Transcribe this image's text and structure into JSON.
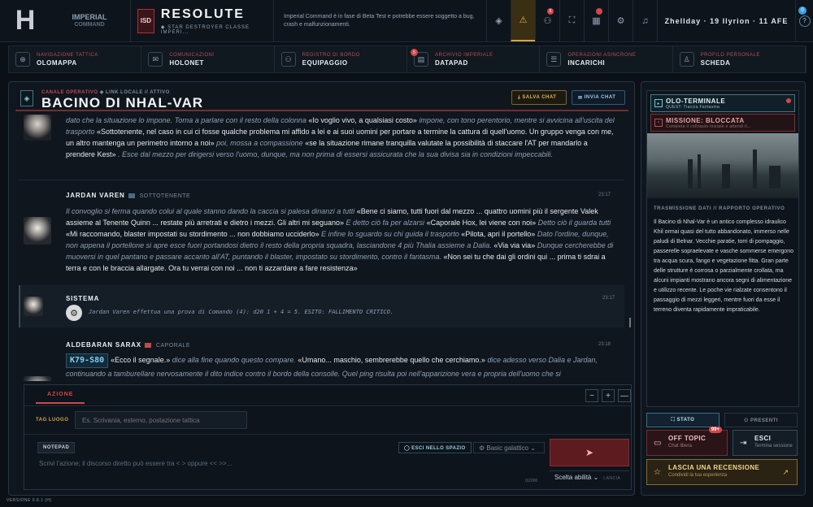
{
  "topbar": {
    "logo": "H",
    "imperial_line1": "IMPERIAL",
    "imperial_line2": "COMMAND",
    "ship_code": "ISD",
    "ship_name": "RESOLUTE",
    "ship_class": "◆ STAR DESTROYER CLASSE IMPERI...",
    "beta_notice": "Imperial Command è in fase di Beta Test e potrebbe essere soggetto a bug, crash e malfunzionamenti.",
    "icons": [
      {
        "name": "starship-icon",
        "glyph": "◈"
      },
      {
        "name": "warning-icon",
        "glyph": "⚠"
      },
      {
        "name": "users-icon",
        "glyph": "⚇",
        "badge": "6"
      },
      {
        "name": "fullscreen-icon",
        "glyph": "⛶"
      },
      {
        "name": "calendar-icon",
        "glyph": "▦",
        "badge": "•"
      },
      {
        "name": "settings-icon",
        "glyph": "⚙"
      },
      {
        "name": "bell-icon",
        "glyph": "♫"
      }
    ],
    "date": "Zhellday · 19 Ilyrion · 11 AFE",
    "help": "?",
    "help_badge": "0"
  },
  "nav": [
    {
      "cat": "NAVIGAZIONE TATTICA",
      "label": "OLOMAPPA",
      "icon": "⊕"
    },
    {
      "cat": "COMUNICAZIONI",
      "label": "HOLONET",
      "icon": "✉"
    },
    {
      "cat": "REGISTRO DI BORDO",
      "label": "EQUIPAGGIO",
      "icon": "⚇"
    },
    {
      "cat": "ARCHIVIO IMPERIALE",
      "label": "DATAPAD",
      "icon": "▤",
      "badge": "5"
    },
    {
      "cat": "OPERAZIONI ASINCRONE",
      "label": "INCARICHI",
      "icon": "☰"
    },
    {
      "cat": "PROFILO PERSONALE",
      "label": "SCHEDA",
      "icon": "♙"
    }
  ],
  "channel": {
    "category": "CANALE OPERATIVO",
    "status": "◆ LINK LOCALE // ATTIVO",
    "title": "BACINO DI NHAL-VAR",
    "save_label": "SALVA CHAT",
    "send_label": "INVIA CHAT"
  },
  "messages": {
    "m1": {
      "text_html": "<i>dato che la situazione lo impone. Torna a parlare con il resto della colonna</i> «Io voglio vivo, a qualsiasi costo» <i>impone, con tono perentorio, mentre si avvicina all'uscita del trasporto</i> «Sottotenente, nel caso in cui ci fosse qualche problema mi affido a lei e ai suoi uomini per portare a termine la cattura di quell'uomo. Un gruppo venga con me, un altro mantenga un perimetro intorno a noi» <i>poi, mossa a compassione</i> «se la situazione rimane tranquilla valutate la possibilità di staccare l'AT per mandarlo a prendere Kest» <i>. Esce dal mezzo per dirigersi verso l'uomo, dunque, ma non prima di essersi assicurata che la sua divisa sia in condizioni impeccabili.</i>"
    },
    "m2": {
      "name": "JARDAN VAREN",
      "rank": "SOTTOTENENTE",
      "time": "23:17",
      "text_html": "<i>Il convoglio si ferma quando colui al quale stanno dando la caccia si palesa dinanzi a tutti</i> «Bene ci siamo, tutti fuori dal mezzo ... quattro uomini più il sergente Valek assieme al Tenente Quinn ... restate più arretrati e dietro i mezzi. Gli altri mi seguano» <i>E detto ciò fa per alzarsi</i> «Caporale Hox, lei viene con noi» <i>Detto ciò il guarda tutti</i> «Mi raccomando, blaster impostati su stordimento ... non dobbiamo ucciderlo» <i>E infine lo sguardo su chi guida il trasporto</i> «Pilota, apri il portello» <i>Dato l'ordine, dunque, non appena il portellone si apre esce fuori portandosi dietro il resto della propria squadra, lasciandone 4 più Thalia assieme a Dalia.</i> «Via via via» <i>Dunque cercherebbe di muoversi in quel pantano e passare accanto all'AT, puntando il blaster, impostato su stordimento, contro il fantasma.</i> «Non sei tu che dai gli ordini qui ... prima ti sdrai a terra e con le braccia allargate. Ora tu verrai con noi ... non ti azzardare a fare resistenza»"
    },
    "m3": {
      "name": "SISTEMA",
      "time": "23:17",
      "text": "Jardan Varen effettua una prova di Comando (4): d20 1 + 4 = 5. ESITO: FALLIMENTO CRITICO."
    },
    "m4": {
      "name": "ALDEBARAN SARAX",
      "rank": "CAPORALE",
      "time": "23:18",
      "code": "K79-S80",
      "text_html": "«Ecco il segnale.» <i>dice alla fine quando questo compare.</i> «Umano... maschio, sembrerebbe quello che cerchiamo.» <i>dice adesso verso Dalia e Jardan, continuando a tamburellare nervosamente il dito indice contro il bordo della consolle. Quel ping risulta poi nell'apparizione vera e propria dell'uomo che si</i>"
    }
  },
  "action": {
    "tab": "AZIONE",
    "zoom_minus": "−",
    "zoom_plus": "+",
    "zoom_collapse": "—",
    "tag_label": "TAG LUOGO",
    "tag_placeholder": "Es. Scrivania, esterno, postazione tattica",
    "notepad": "NOTEPAD",
    "space_exit": "◯ ESCI NELLO SPAZIO",
    "dialect": "⚙  Basic galattico ⌄",
    "placeholder": "Scrivi l'azione; il discorso diretto può essere tra < > oppure << >>...",
    "counter": "0/2000",
    "send_icon": "➤",
    "ability": "Scelta abilità  ⌄",
    "ability_hint": "LANCIA"
  },
  "right": {
    "quest1_title": "OLO-TERMINALE",
    "quest1_sub": "QUEST: Traccia Fantasma",
    "quest2_title": "MISSIONE: BLOCCATA",
    "quest2_sub": "Completa il colloquio iniziale e attendi il...",
    "trans_head": "TRASMISSIONE DATI // RAPPORTO OPERATIVO",
    "trans_text": "Il Bacino di Nhal-Var è un antico complesso idraulico Khil ormai quasi del tutto abbandonato, immerso nelle paludi di Belnar. Vecchie paratie, torri di pompaggio, passerelle sopraelevate e vasche sommerse emergono tra acqua scura, fango e vegetazione fitta. Gran parte delle strutture è corrosa o parzialmente crollata, ma alcuni impianti mostrano ancora segni di alimentazione e utilizzo recente. Le poche vie rialzate consentono il passaggio di mezzi leggeri, mentre fuori da esse il terreno diventa rapidamente impraticabile.",
    "tab_state": "⛶  STATO",
    "tab_present": "⚇  PRESENTI",
    "offtopic_title": "OFF TOPIC",
    "offtopic_sub": "Chat libera",
    "offtopic_badge": "99+",
    "exit_title": "ESCI",
    "exit_sub": "Termina sessione",
    "review_title": "LASCIA UNA RECENSIONE",
    "review_sub": "Condividi la tua esperienza"
  },
  "version": "VERSIONE 0.8.1 (H)"
}
